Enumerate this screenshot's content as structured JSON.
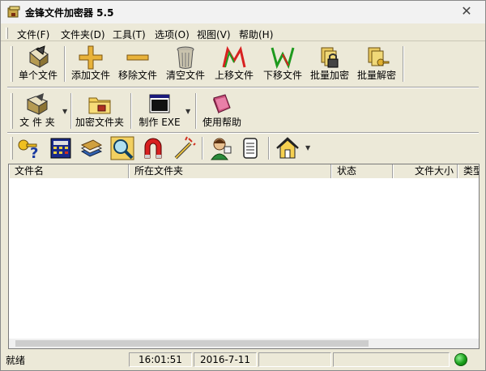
{
  "window": {
    "title": "金锋文件加密器 5.5"
  },
  "menu": [
    {
      "label": "文件(F)"
    },
    {
      "label": "文件夹(D)"
    },
    {
      "label": "工具(T)"
    },
    {
      "label": "选项(O)"
    },
    {
      "label": "视图(V)"
    },
    {
      "label": "帮助(H)"
    }
  ],
  "toolbar1": [
    {
      "label": "单个文件",
      "icon": "single-file-icon"
    },
    {
      "label": "添加文件",
      "icon": "add-file-icon"
    },
    {
      "label": "移除文件",
      "icon": "remove-file-icon"
    },
    {
      "label": "清空文件",
      "icon": "trash-icon"
    },
    {
      "label": "上移文件",
      "icon": "move-up-icon"
    },
    {
      "label": "下移文件",
      "icon": "move-down-icon"
    },
    {
      "label": "批量加密",
      "icon": "batch-encrypt-icon"
    },
    {
      "label": "批量解密",
      "icon": "batch-decrypt-icon"
    }
  ],
  "toolbar2": [
    {
      "label": "文 件 夹",
      "icon": "folder-icon"
    },
    {
      "label": "加密文件夹",
      "icon": "encrypt-folder-icon"
    },
    {
      "label": "制作 EXE",
      "icon": "make-exe-icon"
    },
    {
      "label": "使用帮助",
      "icon": "help-book-icon"
    }
  ],
  "toolbar3_icons": [
    "key-help-icon",
    "calculator-icon",
    "books-icon",
    "magnifier-icon",
    "magnet-icon",
    "wand-icon",
    "person-icon",
    "document-scroll-icon",
    "home-icon"
  ],
  "listview": {
    "columns": [
      "文件名",
      "所在文件夹",
      "状态",
      "文件大小",
      "类型"
    ]
  },
  "statusbar": {
    "status": "就绪",
    "time": "16:01:51",
    "date": "2016-7-11",
    "indicator_color": "#1aa01a"
  }
}
